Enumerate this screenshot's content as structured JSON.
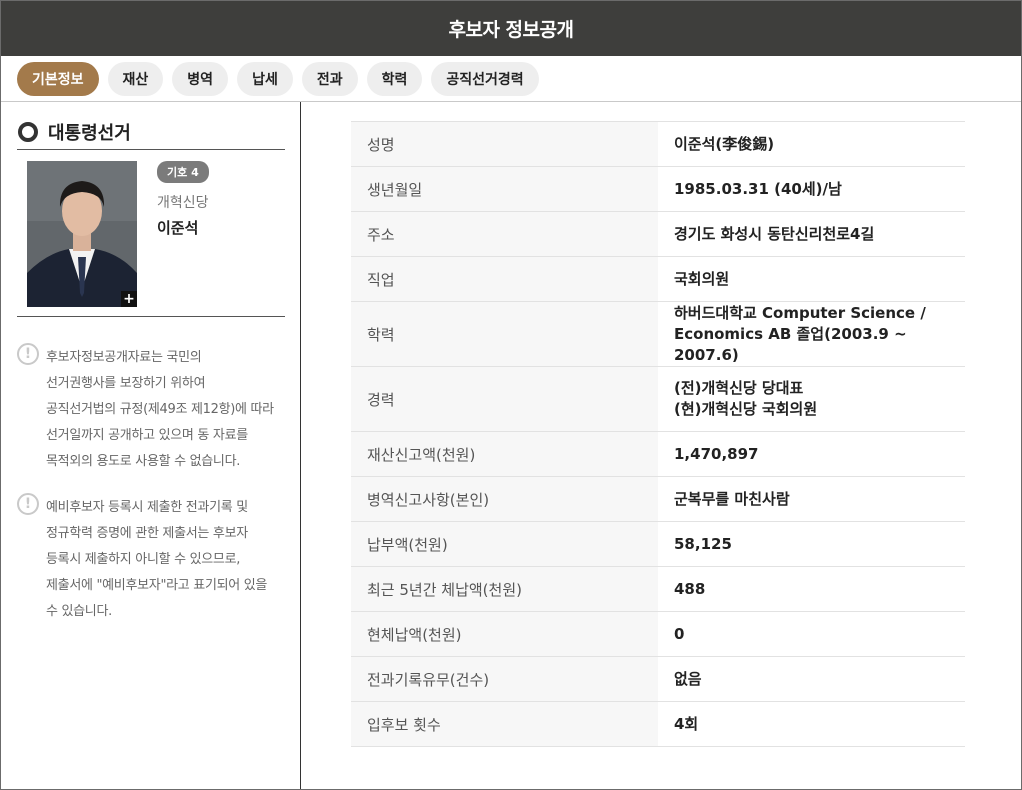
{
  "header": {
    "title": "후보자 정보공개"
  },
  "tabs": [
    {
      "label": "기본정보",
      "active": true
    },
    {
      "label": "재산",
      "active": false
    },
    {
      "label": "병역",
      "active": false
    },
    {
      "label": "납세",
      "active": false
    },
    {
      "label": "전과",
      "active": false
    },
    {
      "label": "학력",
      "active": false
    },
    {
      "label": "공직선거경력",
      "active": false
    }
  ],
  "election": {
    "title": "대통령선거"
  },
  "candidate": {
    "number_badge": "기호 4",
    "party": "개혁신당",
    "name": "이준석",
    "photo_expand_icon": "+"
  },
  "notes": [
    {
      "icon": "!",
      "lines": [
        "후보자정보공개자료는 국민의",
        "선거권행사를 보장하기 위하여",
        "공직선거법의 규정(제49조 제12항)에 따라",
        "선거일까지 공개하고 있으며 동 자료를",
        "목적외의 용도로 사용할 수 없습니다."
      ]
    },
    {
      "icon": "!",
      "lines": [
        "예비후보자 등록시 제출한 전과기록 및",
        "정규학력 증명에 관한 제출서는 후보자",
        "등록시 제출하지 아니할 수 있으므로,",
        "제출서에 \"예비후보자\"라고 표기되어 있을",
        "수 있습니다."
      ]
    }
  ],
  "info": [
    {
      "label": "성명",
      "lines": [
        "이준석(李俊錫)"
      ]
    },
    {
      "label": "생년월일",
      "lines": [
        "1985.03.31 (40세)/남"
      ]
    },
    {
      "label": "주소",
      "lines": [
        "경기도 화성시 동탄신리천로4길"
      ]
    },
    {
      "label": "직업",
      "lines": [
        "국회의원"
      ]
    },
    {
      "label": "학력",
      "lines": [
        "하버드대학교 Computer Science /",
        "Economics AB 졸업(2003.9 ~ 2007.6)"
      ]
    },
    {
      "label": "경력",
      "lines": [
        "(전)개혁신당 당대표",
        "(현)개혁신당 국회의원"
      ]
    },
    {
      "label": "재산신고액(천원)",
      "lines": [
        "1,470,897"
      ]
    },
    {
      "label": "병역신고사항(본인)",
      "lines": [
        "군복무를 마친사람"
      ]
    },
    {
      "label": "납부액(천원)",
      "lines": [
        "58,125"
      ]
    },
    {
      "label": "최근 5년간 체납액(천원)",
      "lines": [
        "488"
      ]
    },
    {
      "label": "현체납액(천원)",
      "lines": [
        "0"
      ]
    },
    {
      "label": "전과기록유무(건수)",
      "lines": [
        "없음"
      ]
    },
    {
      "label": "입후보 횟수",
      "lines": [
        "4회"
      ]
    }
  ],
  "colors": {
    "header_bg": "#3e3e3c",
    "active_tab": "#a37a4b",
    "tab_bg": "#eeeeee",
    "label_bg": "#f7f7f7"
  }
}
